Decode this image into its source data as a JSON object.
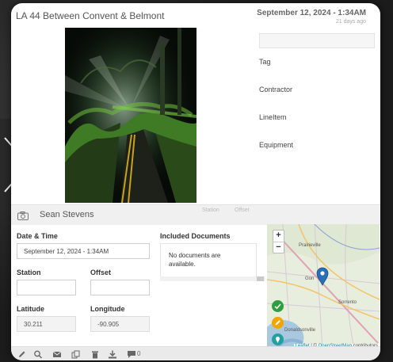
{
  "record": {
    "title": "LA 44 Between Convent & Belmont",
    "date": "September 12, 2024 - 1:34AM",
    "ago": "21 days ago"
  },
  "photo": {
    "icon": "storm-damage-photo"
  },
  "right_fields": {
    "tag_label": "Tag",
    "contractor_label": "Contractor",
    "lineitem_label": "LineItem",
    "equipment_label": "Equipment"
  },
  "author": {
    "name": "Sean Stevens",
    "icon": "camera-icon"
  },
  "band_labels": {
    "station": "Station",
    "offset": "Offset"
  },
  "form": {
    "datetime_label": "Date & Time",
    "datetime_value": "September 12, 2024 - 1:34AM",
    "station_label": "Station",
    "station_value": "",
    "offset_label": "Offset",
    "offset_value": "",
    "latitude_label": "Latitude",
    "latitude_value": "30.211",
    "longitude_label": "Longitude",
    "longitude_value": "-90.905"
  },
  "docs": {
    "label": "Included Documents",
    "empty_text": "No documents are available."
  },
  "map": {
    "zoom_in": "+",
    "zoom_out": "−",
    "attribution_leaflet": "Leaflet",
    "attribution_sep": " | © ",
    "attribution_osm": "OpenStreetMap",
    "attribution_tail": " contributors",
    "places": [
      "Prairieville",
      "Gon",
      "Sorrento",
      "Donaldsonville"
    ],
    "colors": {
      "approve": "#2e9e3e",
      "edit": "#f0a500",
      "locate": "#20a0a0",
      "pin": "#2a6fb5"
    }
  },
  "toolbar": {
    "icons": [
      "edit-icon",
      "zoom-icon",
      "email-icon",
      "copy-icon",
      "trash-icon",
      "download-icon",
      "comment-icon"
    ],
    "comment_count": "0"
  }
}
